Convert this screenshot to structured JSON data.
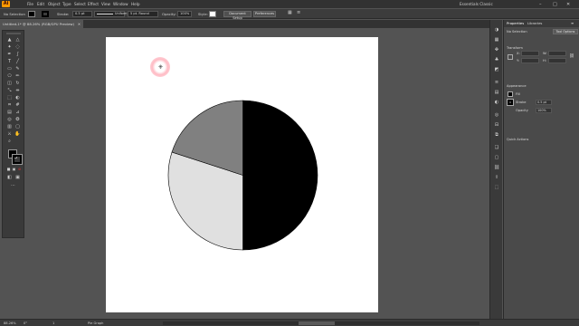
{
  "app": {
    "logo": "Ai"
  },
  "menubar": {
    "items": [
      "File",
      "Edit",
      "Object",
      "Type",
      "Select",
      "Effect",
      "View",
      "Window",
      "Help"
    ],
    "workspace": "Essentials Classic",
    "window_controls": [
      "–",
      "□",
      "✕"
    ]
  },
  "control_bar": {
    "selection": "No Selection",
    "stroke_label": "Stroke:",
    "stroke_value": "0.5 pt",
    "uniform": "Uniform",
    "brush": "5 pt. Round",
    "opacity_label": "Opacity:",
    "opacity_value": "100%",
    "style_label": "Style:",
    "document_setup": "Document Setup",
    "preferences": "Preferences"
  },
  "document": {
    "tab_title": "Untitled-1* @ 88.26% (RGB/GPU Preview)",
    "tab_close": "✕"
  },
  "toolbar": {
    "icons": [
      "selection-tool",
      "direct-selection-tool",
      "pen-tool",
      "curvature-tool",
      "type-tool",
      "line-tool",
      "rectangle-tool",
      "paintbrush-tool",
      "shaper-tool",
      "pencil-tool",
      "eraser-tool",
      "rotate-tool",
      "scale-tool",
      "width-tool",
      "free-transform-tool",
      "shape-builder-tool",
      "perspective-grid-tool",
      "mesh-tool",
      "gradient-tool",
      "eyedropper-tool",
      "blend-tool",
      "symbol-sprayer-tool",
      "column-graph-tool",
      "artboard-tool",
      "slice-tool",
      "hand-tool",
      "zoom-tool"
    ]
  },
  "chart_data": {
    "type": "pie",
    "values": [
      50,
      30,
      20
    ],
    "colors": [
      "#000000",
      "#e0e0e0",
      "#808080"
    ]
  },
  "properties_panel": {
    "tabs": [
      "Properties",
      "Libraries"
    ],
    "no_selection": "No Selection",
    "tool_options": "Tool Options",
    "transform": "Transform",
    "transform_x": "X:",
    "transform_y": "Y:",
    "transform_w": "W:",
    "transform_h": "H:",
    "appearance": "Appearance",
    "fill_label": "Fill",
    "stroke_label": "Stroke",
    "stroke_value": "0.5 pt",
    "opacity_label": "Opacity",
    "opacity_value": "100%",
    "quick_actions": "Quick Actions"
  },
  "status": {
    "zoom": "88.26%",
    "rotation": "0°",
    "artboard_num": "1",
    "tool": "Pie Graph"
  }
}
